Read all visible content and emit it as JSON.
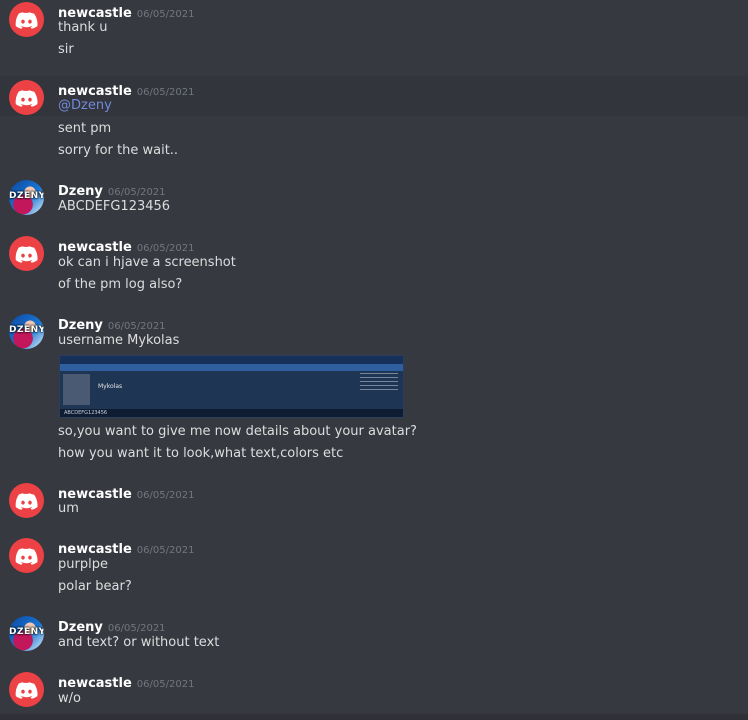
{
  "colors": {
    "background": "#36393f",
    "mention": "#7289da",
    "discord_red": "#ed4245"
  },
  "messages": [
    {
      "author": "newcastle",
      "timestamp": "06/05/2021",
      "avatar": "discord-logo-icon",
      "lines": [
        "thank u",
        "sir"
      ]
    },
    {
      "author": "newcastle",
      "timestamp": "06/05/2021",
      "avatar": "discord-logo-icon",
      "mention": "@Dzeny",
      "lines": [
        "sent pm",
        "sorry for the wait.."
      ]
    },
    {
      "author": "Dzeny",
      "timestamp": "06/05/2021",
      "avatar": "dzeny-avatar",
      "avatar_text": "DZENY",
      "lines": [
        "ABCDEFG123456"
      ]
    },
    {
      "author": "newcastle",
      "timestamp": "06/05/2021",
      "avatar": "discord-logo-icon",
      "lines": [
        "ok can i hjave a screenshot",
        "of the pm log also?"
      ]
    },
    {
      "author": "Dzeny",
      "timestamp": "06/05/2021",
      "avatar": "dzeny-avatar",
      "avatar_text": "DZENY",
      "lines": [
        "username Mykolas"
      ],
      "attachment": {
        "name": "Mykolas",
        "caption": "ABCDEFG123456"
      },
      "lines_after": [
        "so,you want to give me now details about your avatar?",
        "how you want it to look,what text,colors  etc"
      ]
    },
    {
      "author": "newcastle",
      "timestamp": "06/05/2021",
      "avatar": "discord-logo-icon",
      "lines": [
        "um"
      ]
    },
    {
      "author": "newcastle",
      "timestamp": "06/05/2021",
      "avatar": "discord-logo-icon",
      "lines": [
        "purplpe",
        "polar bear?"
      ]
    },
    {
      "author": "Dzeny",
      "timestamp": "06/05/2021",
      "avatar": "dzeny-avatar",
      "avatar_text": "DZENY",
      "lines": [
        "and text? or without text"
      ]
    },
    {
      "author": "newcastle",
      "timestamp": "06/05/2021",
      "avatar": "discord-logo-icon",
      "lines": [
        "w/o"
      ]
    }
  ]
}
